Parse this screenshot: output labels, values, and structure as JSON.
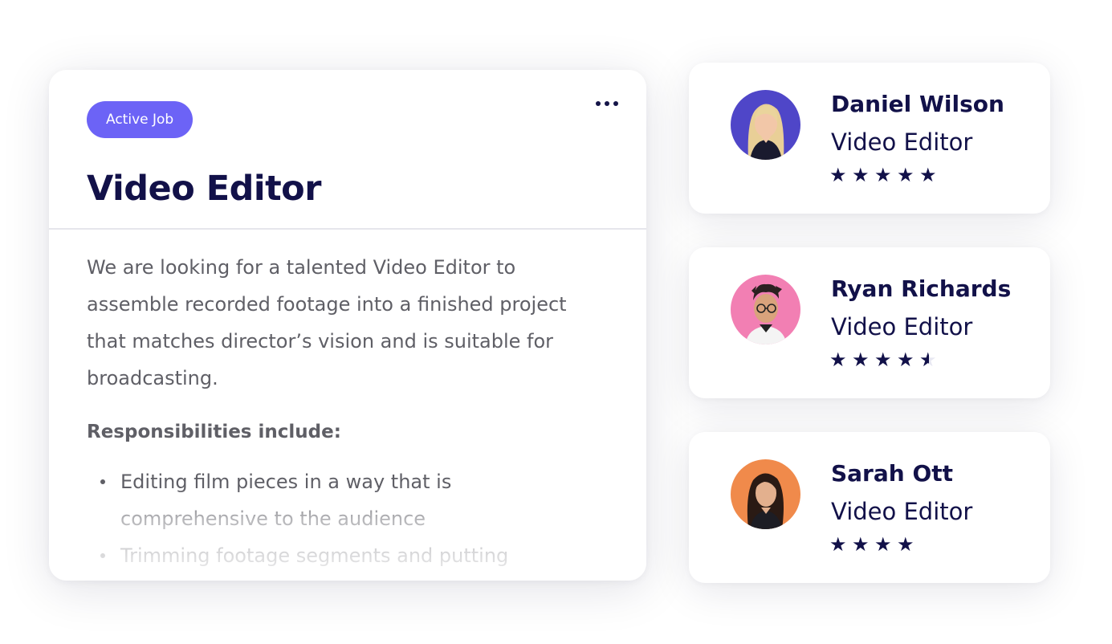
{
  "job": {
    "badge": "Active Job",
    "title": "Video Editor",
    "description": "We are looking for a talented Video Editor to assemble recorded footage into a finished project that matches director’s vision and is suitable for broadcasting.",
    "responsibilities_heading": "Responsibilities include:",
    "responsibilities": [
      "Editing film pieces in a way that is comprehensive to the audience",
      "Trimming footage segments and putting"
    ],
    "menu_icon": "more-horizontal-icon"
  },
  "candidates": [
    {
      "name": "Daniel Wilson",
      "role": "Video Editor",
      "rating": 5,
      "avatar_bg": "#4f46c8"
    },
    {
      "name": "Ryan Richards",
      "role": "Video Editor",
      "rating": 4.5,
      "avatar_bg": "#f27fb3"
    },
    {
      "name": "Sarah Ott",
      "role": "Video Editor",
      "rating": 4,
      "avatar_bg": "#f08a4b"
    }
  ],
  "colors": {
    "accent": "#6c63f6",
    "heading": "#121149",
    "body_text": "#5f5f66",
    "star": "#121149"
  }
}
